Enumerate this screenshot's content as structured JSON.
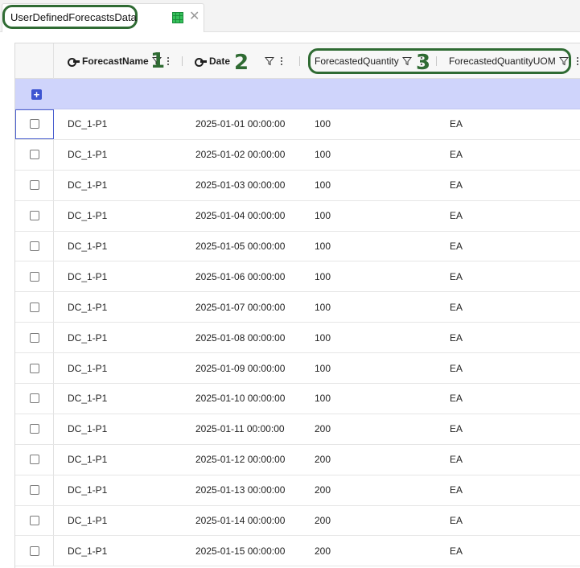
{
  "tab": {
    "title": "UserDefinedForecastsData",
    "icon": "spreadsheet-grid-icon",
    "close_symbol": "✕"
  },
  "annotations": [
    "1",
    "2",
    "3"
  ],
  "columns": [
    {
      "label": "ForecastName",
      "key": true
    },
    {
      "label": "Date",
      "key": true
    },
    {
      "label": "ForecastedQuantity",
      "key": false
    },
    {
      "label": "ForecastedQuantityUOM",
      "key": false
    }
  ],
  "add_row": {
    "symbol": "+"
  },
  "rows": [
    [
      "DC_1-P1",
      "2025-01-01 00:00:00",
      "100",
      "EA"
    ],
    [
      "DC_1-P1",
      "2025-01-02 00:00:00",
      "100",
      "EA"
    ],
    [
      "DC_1-P1",
      "2025-01-03 00:00:00",
      "100",
      "EA"
    ],
    [
      "DC_1-P1",
      "2025-01-04 00:00:00",
      "100",
      "EA"
    ],
    [
      "DC_1-P1",
      "2025-01-05 00:00:00",
      "100",
      "EA"
    ],
    [
      "DC_1-P1",
      "2025-01-06 00:00:00",
      "100",
      "EA"
    ],
    [
      "DC_1-P1",
      "2025-01-07 00:00:00",
      "100",
      "EA"
    ],
    [
      "DC_1-P1",
      "2025-01-08 00:00:00",
      "100",
      "EA"
    ],
    [
      "DC_1-P1",
      "2025-01-09 00:00:00",
      "100",
      "EA"
    ],
    [
      "DC_1-P1",
      "2025-01-10 00:00:00",
      "100",
      "EA"
    ],
    [
      "DC_1-P1",
      "2025-01-11 00:00:00",
      "200",
      "EA"
    ],
    [
      "DC_1-P1",
      "2025-01-12 00:00:00",
      "200",
      "EA"
    ],
    [
      "DC_1-P1",
      "2025-01-13 00:00:00",
      "200",
      "EA"
    ],
    [
      "DC_1-P1",
      "2025-01-14 00:00:00",
      "200",
      "EA"
    ],
    [
      "DC_1-P1",
      "2025-01-15 00:00:00",
      "200",
      "EA"
    ]
  ],
  "colors": {
    "annotation": "#2f6b33",
    "add_row_band": "#cfd4fb",
    "add_button": "#3d55d1"
  }
}
